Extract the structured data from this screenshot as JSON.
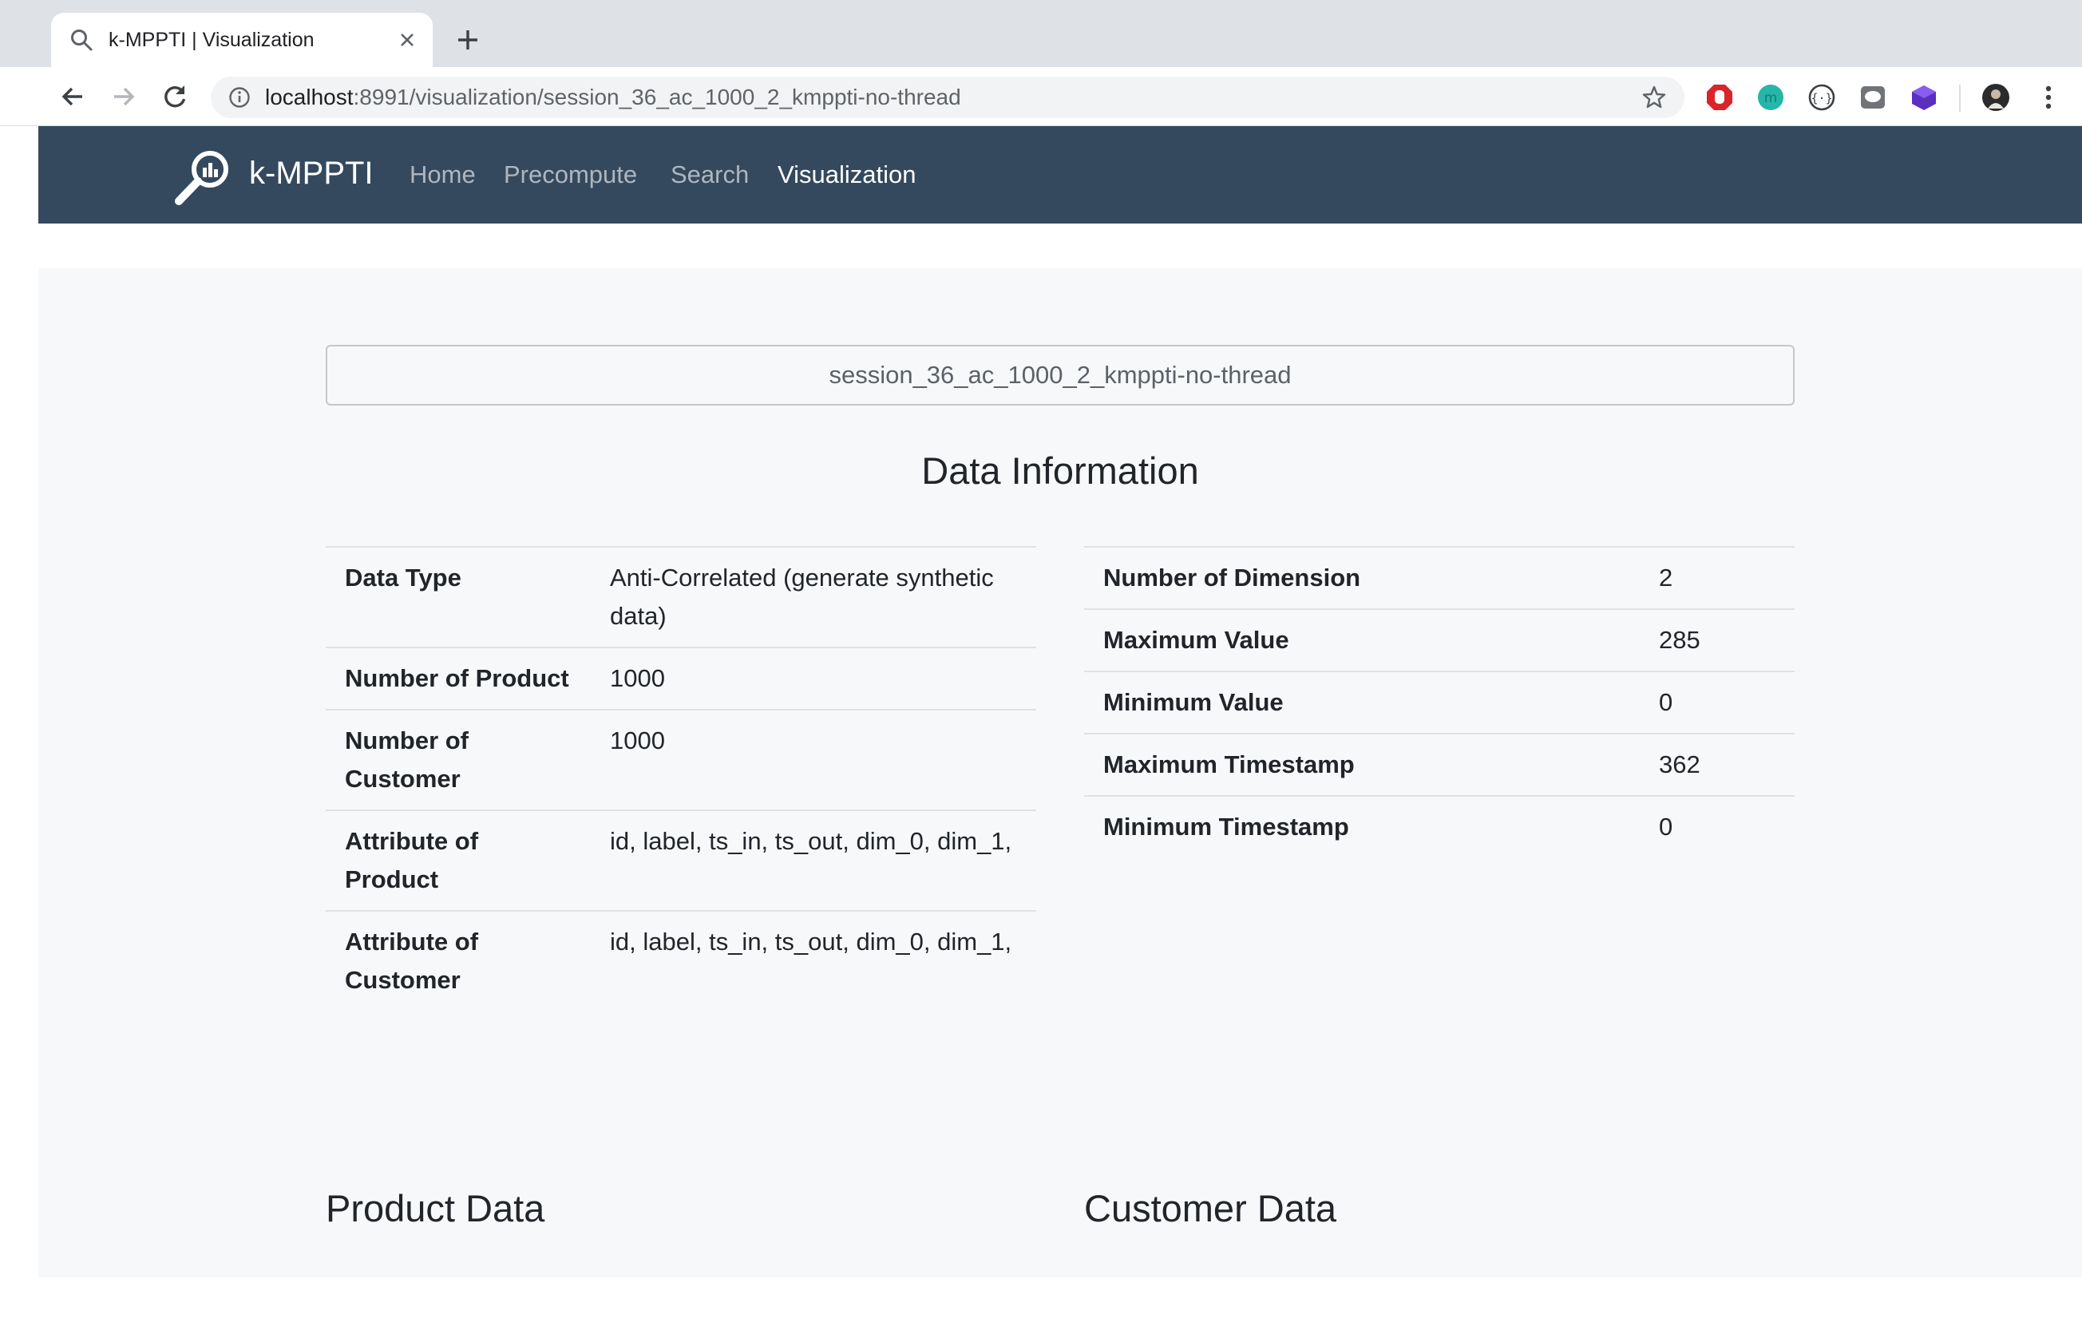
{
  "browser": {
    "tab_title": "k-MPPTI | Visualization",
    "url_host": "localhost",
    "url_rest": ":8991/visualization/session_36_ac_1000_2_kmppti-no-thread"
  },
  "navbar": {
    "brand": "k-MPPTI",
    "links": [
      "Home",
      "Precompute",
      "Search",
      "Visualization"
    ],
    "active": "Visualization",
    "color": "#34495e"
  },
  "session": "session_36_ac_1000_2_kmppti-no-thread",
  "data_info": {
    "title": "Data Information",
    "left": [
      {
        "label": "Data Type",
        "value": "Anti-Correlated (generate synthetic data)"
      },
      {
        "label": "Number of Product",
        "value": "1000"
      },
      {
        "label": "Number of Customer",
        "value": "1000"
      },
      {
        "label": "Attribute of Product",
        "value": "id, label, ts_in, ts_out, dim_0, dim_1,"
      },
      {
        "label": "Attribute of Customer",
        "value": "id, label, ts_in, ts_out, dim_0, dim_1,"
      }
    ],
    "right": [
      {
        "label": "Number of Dimension",
        "value": "2"
      },
      {
        "label": "Maximum Value",
        "value": "285"
      },
      {
        "label": "Minimum Value",
        "value": "0"
      },
      {
        "label": "Maximum Timestamp",
        "value": "362"
      },
      {
        "label": "Minimum Timestamp",
        "value": "0"
      }
    ]
  },
  "product_data_title": "Product Data",
  "customer_data_title": "Customer Data"
}
